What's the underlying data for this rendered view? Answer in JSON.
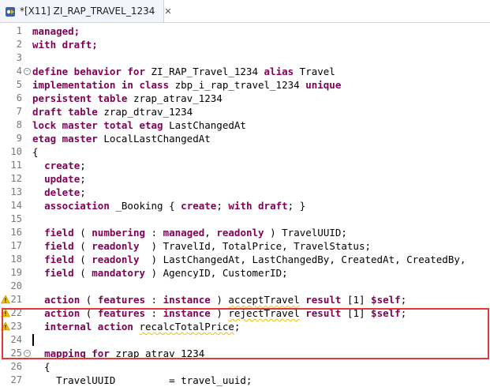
{
  "tab": {
    "title": "*[X11] ZI_RAP_TRAVEL_1234",
    "close_label": "✕",
    "icon": "abap-behavior-definition-icon"
  },
  "editor": {
    "lines": [
      {
        "n": "1",
        "segs": [
          {
            "k": true,
            "t": "managed;"
          }
        ]
      },
      {
        "n": "2",
        "segs": [
          {
            "k": true,
            "t": "with draft;"
          }
        ]
      },
      {
        "n": "3",
        "segs": []
      },
      {
        "n": "4",
        "fold": true,
        "segs": [
          {
            "k": true,
            "t": "define behavior for "
          },
          {
            "t": "ZI_RAP_Travel_1234 "
          },
          {
            "k": true,
            "t": "alias "
          },
          {
            "t": "Travel"
          }
        ]
      },
      {
        "n": "5",
        "segs": [
          {
            "k": true,
            "t": "implementation in class "
          },
          {
            "t": "zbp_i_rap_travel_1234 "
          },
          {
            "k": true,
            "t": "unique"
          }
        ]
      },
      {
        "n": "6",
        "segs": [
          {
            "k": true,
            "t": "persistent table "
          },
          {
            "t": "zrap_atrav_1234"
          }
        ]
      },
      {
        "n": "7",
        "segs": [
          {
            "k": true,
            "t": "draft table "
          },
          {
            "t": "zrap_dtrav_1234"
          }
        ]
      },
      {
        "n": "8",
        "segs": [
          {
            "k": true,
            "t": "lock master total etag "
          },
          {
            "t": "LastChangedAt"
          }
        ]
      },
      {
        "n": "9",
        "segs": [
          {
            "k": true,
            "t": "etag master "
          },
          {
            "t": "LocalLastChangedAt"
          }
        ]
      },
      {
        "n": "10",
        "segs": [
          {
            "t": "{"
          }
        ]
      },
      {
        "n": "11",
        "segs": [
          {
            "t": "  "
          },
          {
            "k": true,
            "t": "create"
          },
          {
            "t": ";"
          }
        ]
      },
      {
        "n": "12",
        "segs": [
          {
            "t": "  "
          },
          {
            "k": true,
            "t": "update"
          },
          {
            "t": ";"
          }
        ]
      },
      {
        "n": "13",
        "segs": [
          {
            "t": "  "
          },
          {
            "k": true,
            "t": "delete"
          },
          {
            "t": ";"
          }
        ]
      },
      {
        "n": "14",
        "segs": [
          {
            "t": "  "
          },
          {
            "k": true,
            "t": "association "
          },
          {
            "t": "_Booking { "
          },
          {
            "k": true,
            "t": "create"
          },
          {
            "t": "; "
          },
          {
            "k": true,
            "t": "with draft"
          },
          {
            "t": "; }"
          }
        ]
      },
      {
        "n": "15",
        "segs": []
      },
      {
        "n": "16",
        "segs": [
          {
            "t": "  "
          },
          {
            "k": true,
            "t": "field "
          },
          {
            "t": "( "
          },
          {
            "k": true,
            "t": "numbering "
          },
          {
            "t": ": "
          },
          {
            "k": true,
            "t": "managed"
          },
          {
            "t": ", "
          },
          {
            "k": true,
            "t": "readonly "
          },
          {
            "t": ") TravelUUID;"
          }
        ]
      },
      {
        "n": "17",
        "segs": [
          {
            "t": "  "
          },
          {
            "k": true,
            "t": "field "
          },
          {
            "t": "( "
          },
          {
            "k": true,
            "t": "readonly  "
          },
          {
            "t": ") TravelId, TotalPrice, TravelStatus;"
          }
        ]
      },
      {
        "n": "18",
        "segs": [
          {
            "t": "  "
          },
          {
            "k": true,
            "t": "field "
          },
          {
            "t": "( "
          },
          {
            "k": true,
            "t": "readonly  "
          },
          {
            "t": ") LastChangedAt, LastChangedBy, CreatedAt, CreatedBy,"
          }
        ]
      },
      {
        "n": "19",
        "segs": [
          {
            "t": "  "
          },
          {
            "k": true,
            "t": "field "
          },
          {
            "t": "( "
          },
          {
            "k": true,
            "t": "mandatory "
          },
          {
            "t": ") AgencyID, CustomerID;"
          }
        ]
      },
      {
        "n": "20",
        "segs": []
      },
      {
        "n": "21",
        "warn": true,
        "segs": [
          {
            "t": "  "
          },
          {
            "k": true,
            "t": "action "
          },
          {
            "t": "( "
          },
          {
            "k": true,
            "t": "features "
          },
          {
            "t": ": "
          },
          {
            "k": true,
            "t": "instance "
          },
          {
            "t": ") "
          },
          {
            "s": true,
            "t": "acceptTravel"
          },
          {
            "t": " "
          },
          {
            "k": true,
            "t": "result "
          },
          {
            "t": "[1] "
          },
          {
            "k": true,
            "t": "$self"
          },
          {
            "t": ";"
          }
        ]
      },
      {
        "n": "22",
        "warn": true,
        "segs": [
          {
            "t": "  "
          },
          {
            "k": true,
            "t": "action "
          },
          {
            "t": "( "
          },
          {
            "k": true,
            "t": "features "
          },
          {
            "t": ": "
          },
          {
            "k": true,
            "t": "instance "
          },
          {
            "t": ") "
          },
          {
            "s": true,
            "t": "rejectTravel"
          },
          {
            "t": " "
          },
          {
            "k": true,
            "t": "result "
          },
          {
            "t": "[1] "
          },
          {
            "k": true,
            "t": "$self"
          },
          {
            "t": ";"
          }
        ]
      },
      {
        "n": "23",
        "warn": true,
        "segs": [
          {
            "t": "  "
          },
          {
            "k": true,
            "t": "internal action "
          },
          {
            "s": true,
            "t": "recalcTotalPrice"
          },
          {
            "t": ";"
          }
        ]
      },
      {
        "n": "24",
        "segs": []
      },
      {
        "n": "25",
        "fold": true,
        "segs": [
          {
            "t": "  "
          },
          {
            "k": true,
            "t": "mapping for "
          },
          {
            "t": "zrap_atrav_1234"
          }
        ]
      },
      {
        "n": "26",
        "segs": [
          {
            "t": "  {"
          }
        ]
      },
      {
        "n": "27",
        "segs": [
          {
            "t": "    TravelUUID         = travel_uuid;"
          }
        ]
      }
    ]
  }
}
